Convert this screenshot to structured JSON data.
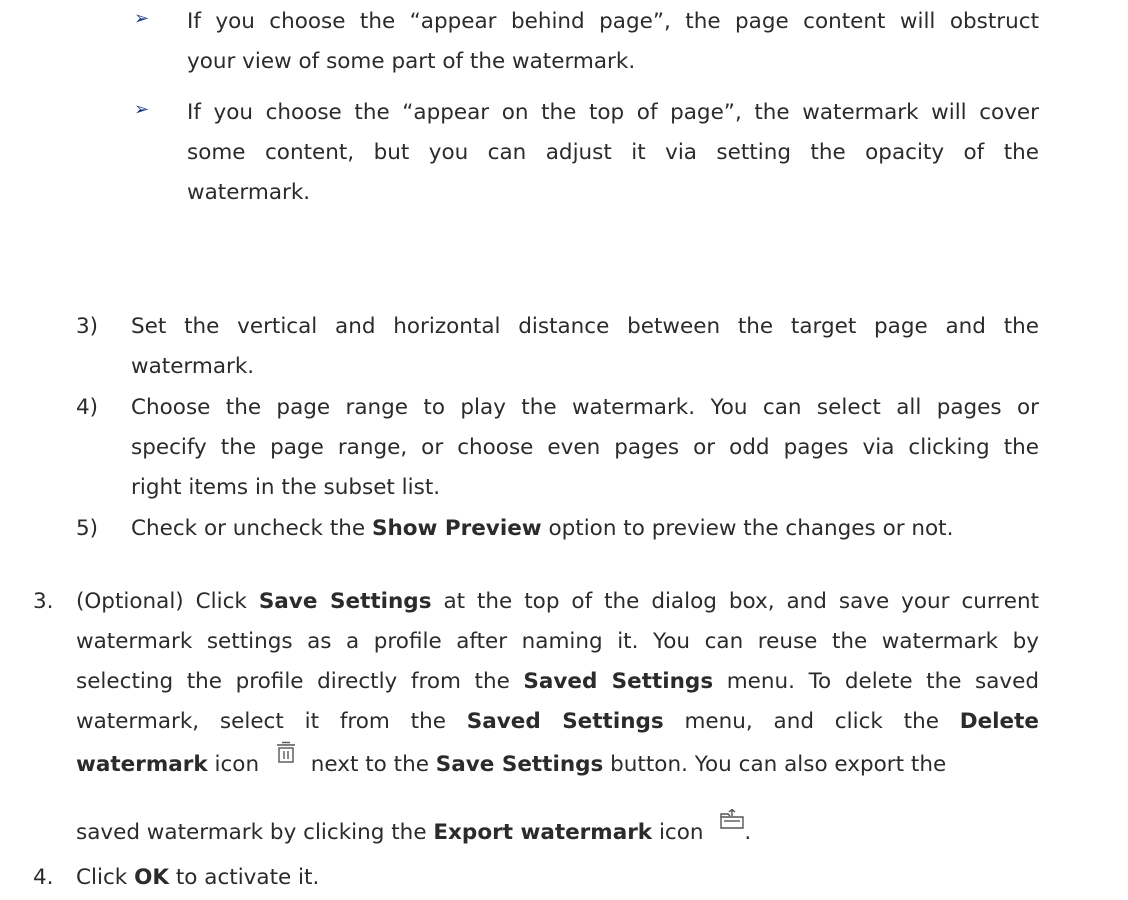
{
  "bullets": [
    {
      "marker": "➢",
      "lines": [
        "If you choose the “appear behind page”, the page content will obstruct",
        "your view of some part of the watermark."
      ]
    },
    {
      "marker": "➢",
      "lines": [
        "If you choose the “appear on the top of page”, the watermark will cover",
        "some content, but you can adjust it via setting the opacity of the",
        "watermark."
      ]
    }
  ],
  "substeps": [
    {
      "num": "3)",
      "lines": [
        "Set the vertical and horizontal distance between the target page and the",
        "watermark."
      ]
    },
    {
      "num": "4)",
      "lines": [
        "Choose the page range to play the watermark. You can select all pages or",
        "specify the page range, or choose even pages or odd pages via clicking the",
        "right items in the subset list."
      ]
    },
    {
      "num": "5)",
      "pre": "Check or uncheck the ",
      "bold": "Show Preview",
      "post": " option to preview the changes or not."
    }
  ],
  "step3": {
    "num": "3.",
    "l1_pre": "(Optional) Click ",
    "l1_b1": "Save Settings",
    "l1_post": " at the top of the dialog box, and save your current",
    "l2": "watermark settings as a profile after naming it. You can reuse the watermark by",
    "l3_pre": "selecting the profile directly from the ",
    "l3_b1": "Saved Settings",
    "l3_post": " menu. To delete the saved",
    "l4_pre": "watermark, select it from the ",
    "l4_b1": "Saved Settings",
    "l4_mid": " menu, and click the ",
    "l4_b2": "Delete",
    "l5_b1": "watermark",
    "l5_mid1": " icon",
    "l5_mid2": " next to the ",
    "l5_b2": "Save Settings",
    "l5_post": " button. You can also export the",
    "l6_pre": "saved watermark by clicking the ",
    "l6_b1": "Export watermark",
    "l6_mid": " icon",
    "l6_post": ".",
    "delete_icon": "trash-icon",
    "export_icon": "export-folder-icon"
  },
  "step4": {
    "num": "4.",
    "pre": "Click ",
    "bold": "OK",
    "post": " to activate it."
  }
}
